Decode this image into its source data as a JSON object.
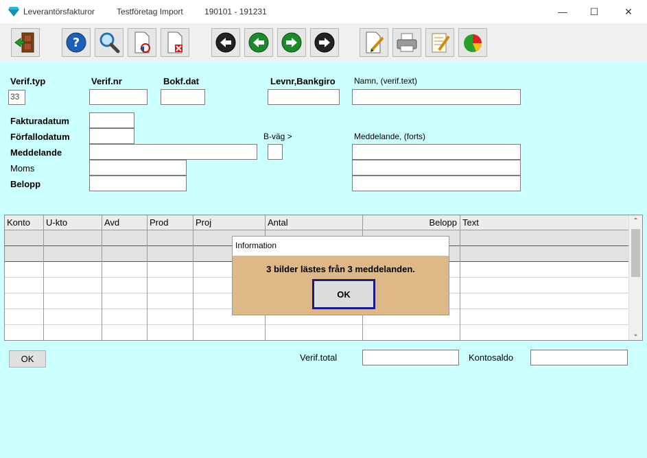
{
  "window": {
    "title": "Leverantörsfakturor",
    "company": "Testföretag Import",
    "period": "190101 - 191231",
    "minimize": "—",
    "maximize": "☐",
    "close": "✕"
  },
  "toolbar": {
    "buttons": [
      "exit-door-icon",
      "help-icon",
      "search-icon",
      "document-arrow-icon",
      "document-delete-icon",
      "first-record-icon",
      "previous-record-icon",
      "next-record-icon",
      "last-record-icon",
      "edit-document-icon",
      "printer-icon",
      "notepad-pen-icon",
      "pie-chart-icon"
    ]
  },
  "form": {
    "verif_typ_label": "Verif.typ",
    "verif_typ_value": "33",
    "verif_nr_label": "Verif.nr",
    "bokf_dat_label": "Bokf.dat",
    "levnr_label": "Levnr,Bankgiro",
    "namn_label": "Namn, (verif.text)",
    "fakturadatum_label": "Fakturadatum",
    "forfallodatum_label": "Förfallodatum",
    "meddelande_label": "Meddelande",
    "moms_label": "Moms",
    "belopp_label": "Belopp",
    "bvag_label": "B-väg >",
    "meddelande_forts_label": "Meddelande, (forts)"
  },
  "grid": {
    "columns": [
      "Konto",
      "U-kto",
      "Avd",
      "Prod",
      "Proj",
      "Antal",
      "Belopp",
      "Text"
    ]
  },
  "footer": {
    "ok_label": "OK",
    "verif_total_label": "Verif.total",
    "kontosaldo_label": "Kontosaldo"
  },
  "dialog": {
    "title": "Information",
    "message": "3 bilder lästes från 3 meddelanden.",
    "ok_label": "OK"
  },
  "colors": {
    "background": "#ccffff",
    "dialog_bg": "#deb887",
    "dialog_ok_border": "#1a1a80"
  }
}
